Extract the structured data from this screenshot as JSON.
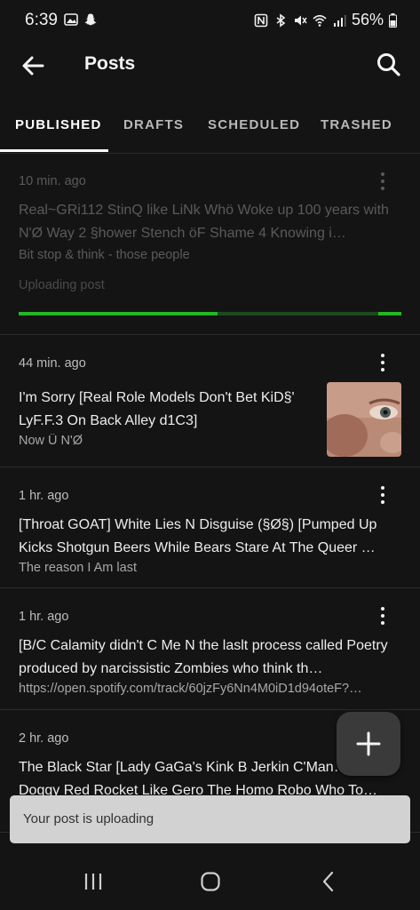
{
  "status_bar": {
    "time": "6:39",
    "battery": "56%",
    "icons": [
      "gallery-icon",
      "snapchat-icon",
      "nfc-icon",
      "bluetooth-icon",
      "mute-icon",
      "wifi-icon",
      "signal-icon",
      "battery-icon"
    ]
  },
  "appbar": {
    "title": "Posts",
    "back_icon": "arrow-left-icon",
    "search_icon": "search-icon"
  },
  "tabs": [
    {
      "label": "PUBLISHED",
      "active": true
    },
    {
      "label": "DRAFTS",
      "active": false
    },
    {
      "label": "SCHEDULED",
      "active": false
    },
    {
      "label": "TRASHED",
      "active": false
    }
  ],
  "posts": [
    {
      "time": "10 min. ago",
      "title": "Real~GRi112 StinQ like LiNk Whö Woke up 100 years with N'Ø Way 2 §hower Stench öF Shame 4 Knowing i…",
      "subtitle": "Bit stop & think - those people",
      "status": "Uploading post",
      "progress": 0.52
    },
    {
      "time": "44 min. ago",
      "title": "I'm Sorry [Real Role Models Don't Bet KiD§' LyF.F.3 On Back Alley d1C3]",
      "subtitle": "Now Ü N'Ø",
      "has_thumbnail": true
    },
    {
      "time": "1 hr. ago",
      "title": "[Throat GOAT] White Lies N Disguise (§Ø§) [Pumped Up Kicks Shotgun Beers While Bears Stare At The Queer …",
      "subtitle": "The reason I Am last"
    },
    {
      "time": "1 hr. ago",
      "title": "[B/C Calamity didn't C Me N the laslt process called Poetry produced by narcissistic Zombies who think th…",
      "subtitle": "https://open.spotify.com/track/60jzFy6Nn4M0iD1d94oteF?…"
    },
    {
      "time": "2 hr. ago",
      "title": "The Black Star [Lady GaGa's Kink B Jerkin C'Man… Doggy Red Rocket Like Gero The Homo Robo Who To…",
      "subtitle": ""
    }
  ],
  "fab": {
    "icon": "plus-icon"
  },
  "snackbar": {
    "text": "Your post is uploading"
  },
  "colors": {
    "background": "#141414",
    "progress": "#25b525",
    "progress_track": "#1d4a1d",
    "snackbar": "#d2d2d2"
  }
}
